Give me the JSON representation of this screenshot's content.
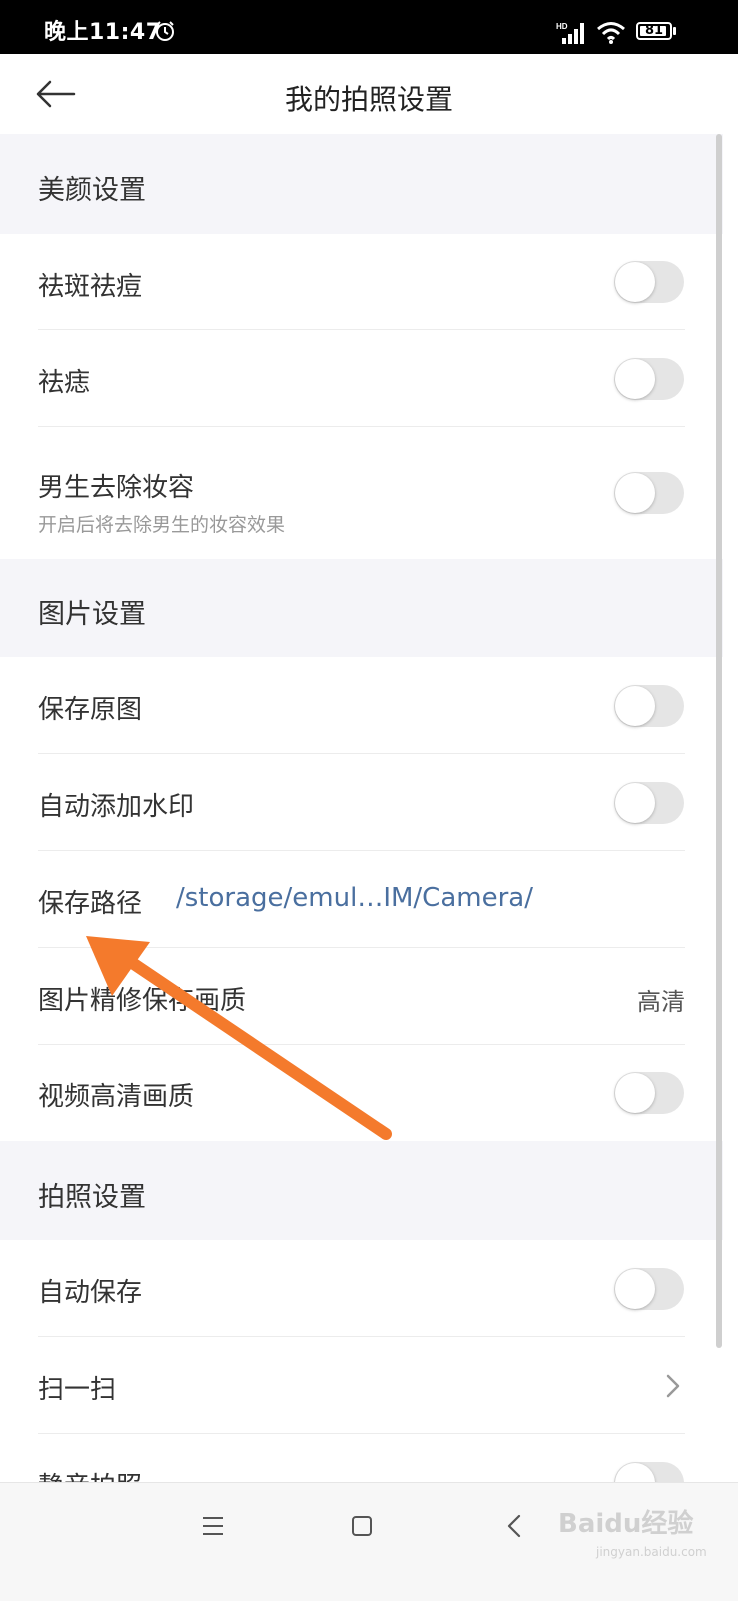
{
  "status_bar": {
    "time": "晚上11:47",
    "battery_level": "81",
    "icons": [
      "alarm-icon",
      "signal-icon",
      "wifi-icon",
      "battery-icon"
    ]
  },
  "header": {
    "back_icon": "arrow-left-icon",
    "title": "我的拍照设置"
  },
  "sections": [
    {
      "title": "美颜设置",
      "rows": [
        {
          "label": "祛斑祛痘",
          "toggle": false
        },
        {
          "label": "祛痣",
          "toggle": false
        },
        {
          "label": "男生去除妆容",
          "subtitle": "开启后将去除男生的妆容效果",
          "toggle": false
        }
      ]
    },
    {
      "title": "图片设置",
      "rows": [
        {
          "label": "保存原图",
          "toggle": false
        },
        {
          "label": "自动添加水印",
          "toggle": false
        },
        {
          "label": "保存路径",
          "value": "/storage/emul…IM/Camera/"
        },
        {
          "label": "图片精修保存画质",
          "value": "高清"
        },
        {
          "label": "视频高清画质",
          "toggle": false
        }
      ]
    },
    {
      "title": "拍照设置",
      "rows": [
        {
          "label": "自动保存",
          "toggle": false
        },
        {
          "label": "扫一扫",
          "icon": "chevron-right-icon"
        },
        {
          "label": "静音拍照",
          "toggle": false
        }
      ]
    }
  ],
  "nav_bar": {
    "icons": [
      "menu-icon",
      "home-square-icon",
      "back-chevron-icon"
    ],
    "watermark": "Baidu经验",
    "watermark_sub": "jingyan.baidu.com"
  },
  "annotation": {
    "type": "arrow",
    "color": "#f47a2c"
  }
}
